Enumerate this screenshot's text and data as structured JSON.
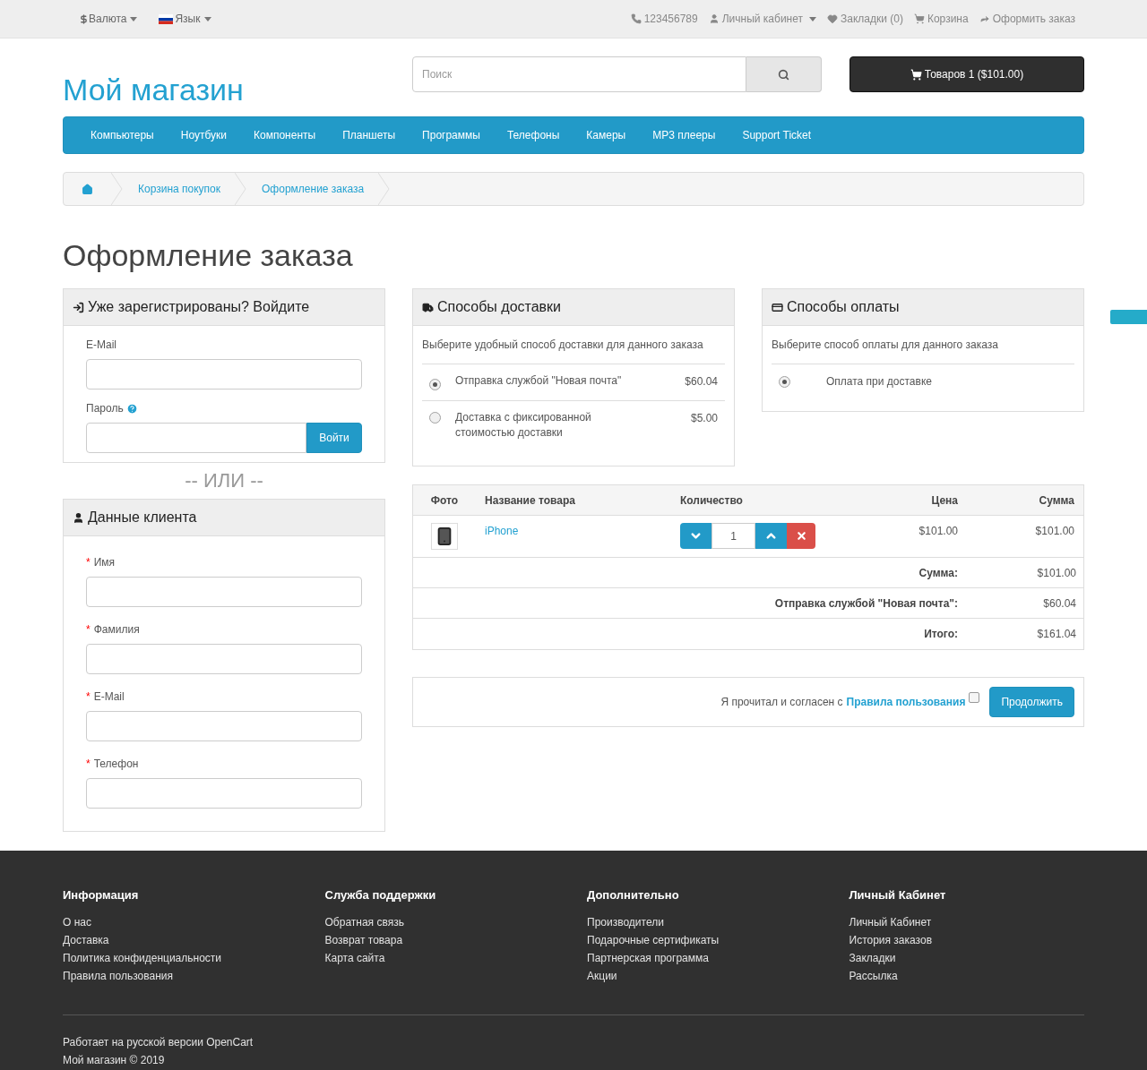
{
  "top_bar": {
    "currency": "Валюта",
    "language": "Язык",
    "links": [
      {
        "kind": "phone",
        "label": "123456789"
      },
      {
        "kind": "account",
        "label": "Личный кабинет",
        "dropdown": true
      },
      {
        "kind": "wishlist",
        "label": "Закладки (0)"
      },
      {
        "kind": "cart",
        "label": "Корзина"
      },
      {
        "kind": "checkout",
        "label": "Оформить заказ"
      }
    ]
  },
  "header": {
    "logo": "Мой магазин",
    "search": {
      "placeholder": "Поиск"
    },
    "cart_button": "Товаров 1 ($101.00)"
  },
  "menu": [
    "Компьютеры",
    "Ноутбуки",
    "Компоненты",
    "Планшеты",
    "Программы",
    "Телефоны",
    "Камеры",
    "MP3 плееры",
    "Support Ticket"
  ],
  "breadcrumb": [
    "Корзина покупок",
    "Оформление заказа"
  ],
  "page_title": "Оформление заказа",
  "login": {
    "title": "Уже зарегистрированы? Войдите",
    "email_label": "E-Mail",
    "password_label": "Пароль",
    "button": "Войти"
  },
  "or_text": "-- ИЛИ --",
  "customer": {
    "title": "Данные клиента",
    "fields": [
      {
        "label": "Имя",
        "required_mark": "*"
      },
      {
        "label": "Фамилия",
        "required_mark": "*"
      },
      {
        "label": "E-Mail",
        "required_mark": "*"
      },
      {
        "label": "Телефон",
        "required_mark": "*"
      }
    ]
  },
  "shipping": {
    "title": "Способы доставки",
    "hint": "Выберите удобный способ доставки для данного заказа",
    "options": [
      {
        "label": "Отправка службой \"Новая почта\"",
        "price": "$60.04",
        "selected": true
      },
      {
        "label": "Доставка с фиксированной стоимостью доставки",
        "price": "$5.00",
        "selected": false
      }
    ]
  },
  "payment": {
    "title": "Способы оплаты",
    "hint": "Выберите способ оплаты для данного заказа",
    "options": [
      {
        "label": "Оплата при доставке",
        "selected": true
      }
    ]
  },
  "cart_table": {
    "columns": [
      "Фото",
      "Название товара",
      "Количество",
      "Цена",
      "Сумма"
    ],
    "rows": [
      {
        "name": "iPhone",
        "quantity": "1",
        "price": "$101.00",
        "total": "$101.00"
      }
    ],
    "totals": [
      {
        "label": "Сумма:",
        "value": "$101.00"
      },
      {
        "label": "Отправка службой \"Новая почта\":",
        "value": "$60.04"
      },
      {
        "label": "Итого:",
        "value": "$161.04"
      }
    ]
  },
  "agree": {
    "text": "Я прочитал и согласен с",
    "link": "Правила пользования",
    "checked": false,
    "button": "Продолжить"
  },
  "footer": {
    "columns": [
      {
        "title": "Информация",
        "links": [
          "О нас",
          "Доставка",
          "Политика конфиденциальности",
          "Правила пользования"
        ]
      },
      {
        "title": "Служба поддержки",
        "links": [
          "Обратная связь",
          "Возврат товара",
          "Карта сайта"
        ]
      },
      {
        "title": "Дополнительно",
        "links": [
          "Производители",
          "Подарочные сертификаты",
          "Партнерская программа",
          "Акции"
        ]
      },
      {
        "title": "Личный Кабинет",
        "links": [
          "Личный Кабинет",
          "История заказов",
          "Закладки",
          "Рассылка"
        ]
      }
    ],
    "powered": "Работает на русской версии OpenCart",
    "copyright": "Мой магазин © 2019"
  }
}
